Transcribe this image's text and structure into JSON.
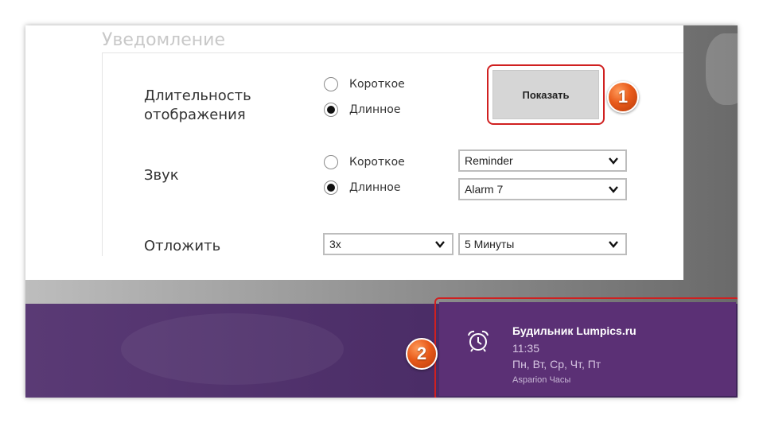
{
  "section": {
    "title": "Уведомление"
  },
  "duration": {
    "label_line1": "Длительность",
    "label_line2": "отображения",
    "options": [
      "Короткое",
      "Длинное"
    ],
    "selected": "Длинное",
    "show_button_label": "Показать"
  },
  "sound": {
    "label": "Звук",
    "options": [
      "Короткое",
      "Длинное"
    ],
    "selected": "Длинное",
    "short_sound_select": "Reminder",
    "long_sound_select": "Alarm 7"
  },
  "snooze": {
    "label": "Отложить",
    "count_select": "3x",
    "interval_select": "5 Минуты"
  },
  "badges": {
    "first": "1",
    "second": "2"
  },
  "toast": {
    "title": "Будильник Lumpics.ru",
    "time": "11:35",
    "days": "Пн, Вт, Ср, Чт, Пт",
    "app": "Asparion Часы",
    "icon": "alarm-clock-icon"
  },
  "colors": {
    "toast_bg": "#5b3075",
    "highlight_border": "#d02020",
    "badge": "#e85a1a"
  }
}
